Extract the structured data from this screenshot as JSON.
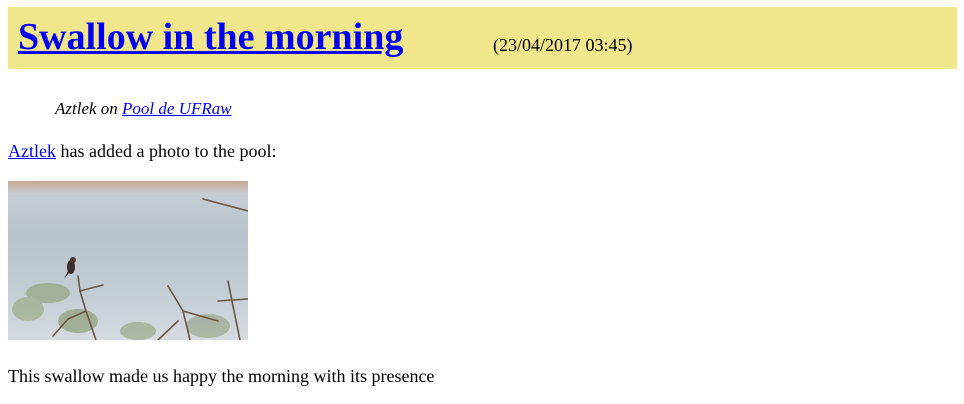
{
  "post": {
    "title": "Swallow in the morning",
    "date": "(23/04/2017 03:45)",
    "author": "Aztlek",
    "on_word": "on",
    "pool_name": "Pool de UFRaw",
    "intro_rest": " has added a photo to the pool:",
    "caption": "This swallow made us happy the morning with its presence"
  },
  "colors": {
    "header_bg": "#f0e68c",
    "link": "#0000ee"
  }
}
